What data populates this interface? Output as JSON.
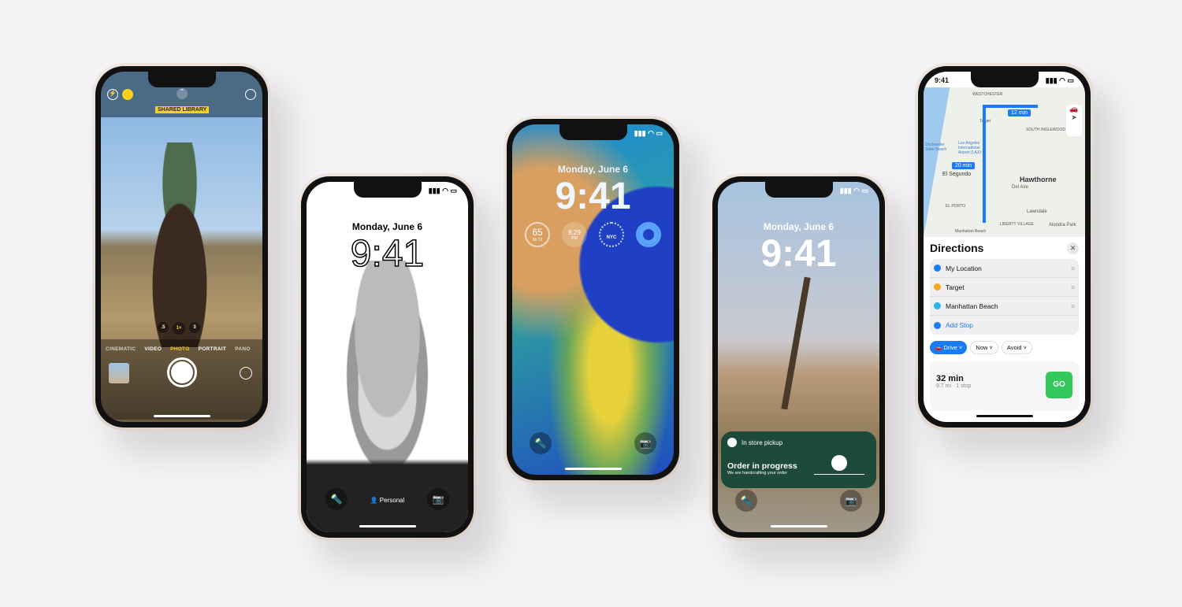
{
  "camera": {
    "badge": "SHARED LIBRARY",
    "zoom": [
      ".5",
      "1×",
      "3"
    ],
    "modes": [
      "CINEMATIC",
      "VIDEO",
      "PHOTO",
      "PORTRAIT",
      "PANO"
    ],
    "selected_mode": "PHOTO",
    "accent": "#f7d21c"
  },
  "lock_bw": {
    "date": "Monday, June 6",
    "time": "9:41",
    "focus": "Personal"
  },
  "lock_color": {
    "date": "Monday, June 6",
    "time": "9:41",
    "widgets": {
      "temp": "65",
      "range": "55  72",
      "clock": "8:29",
      "clock_sub": "PM",
      "city": "NYC"
    }
  },
  "lock_desert": {
    "date": "Monday, June 6",
    "time": "9:41",
    "activity": {
      "title": "In store pickup",
      "status": "Order in progress",
      "detail": "We are handcrafting your order",
      "color": "#1e4a3a"
    }
  },
  "maps": {
    "status_time": "9:41",
    "map_labels": [
      "WESTCHESTER",
      "Target",
      "12 min",
      "SOUTH INGLEWOOD",
      "Dockweiler State Beach",
      "Los Angeles International Airport (LAX)",
      "20 min",
      "El Segundo",
      "Hawthorne",
      "Del Aire",
      "EL PORTO",
      "Lawndale",
      "LIBERTY VILLAGE",
      "Alondra Park",
      "Manhattan Beach"
    ],
    "title": "Directions",
    "stops": [
      "My Location",
      "Target",
      "Manhattan Beach"
    ],
    "add_stop": "Add Stop",
    "options": [
      "Drive",
      "Now",
      "Avoid"
    ],
    "duration": "32 min",
    "summary": "9.7 mi · 1 stop",
    "go": "GO",
    "accent": "#1a7cf5",
    "go_color": "#34c759"
  }
}
